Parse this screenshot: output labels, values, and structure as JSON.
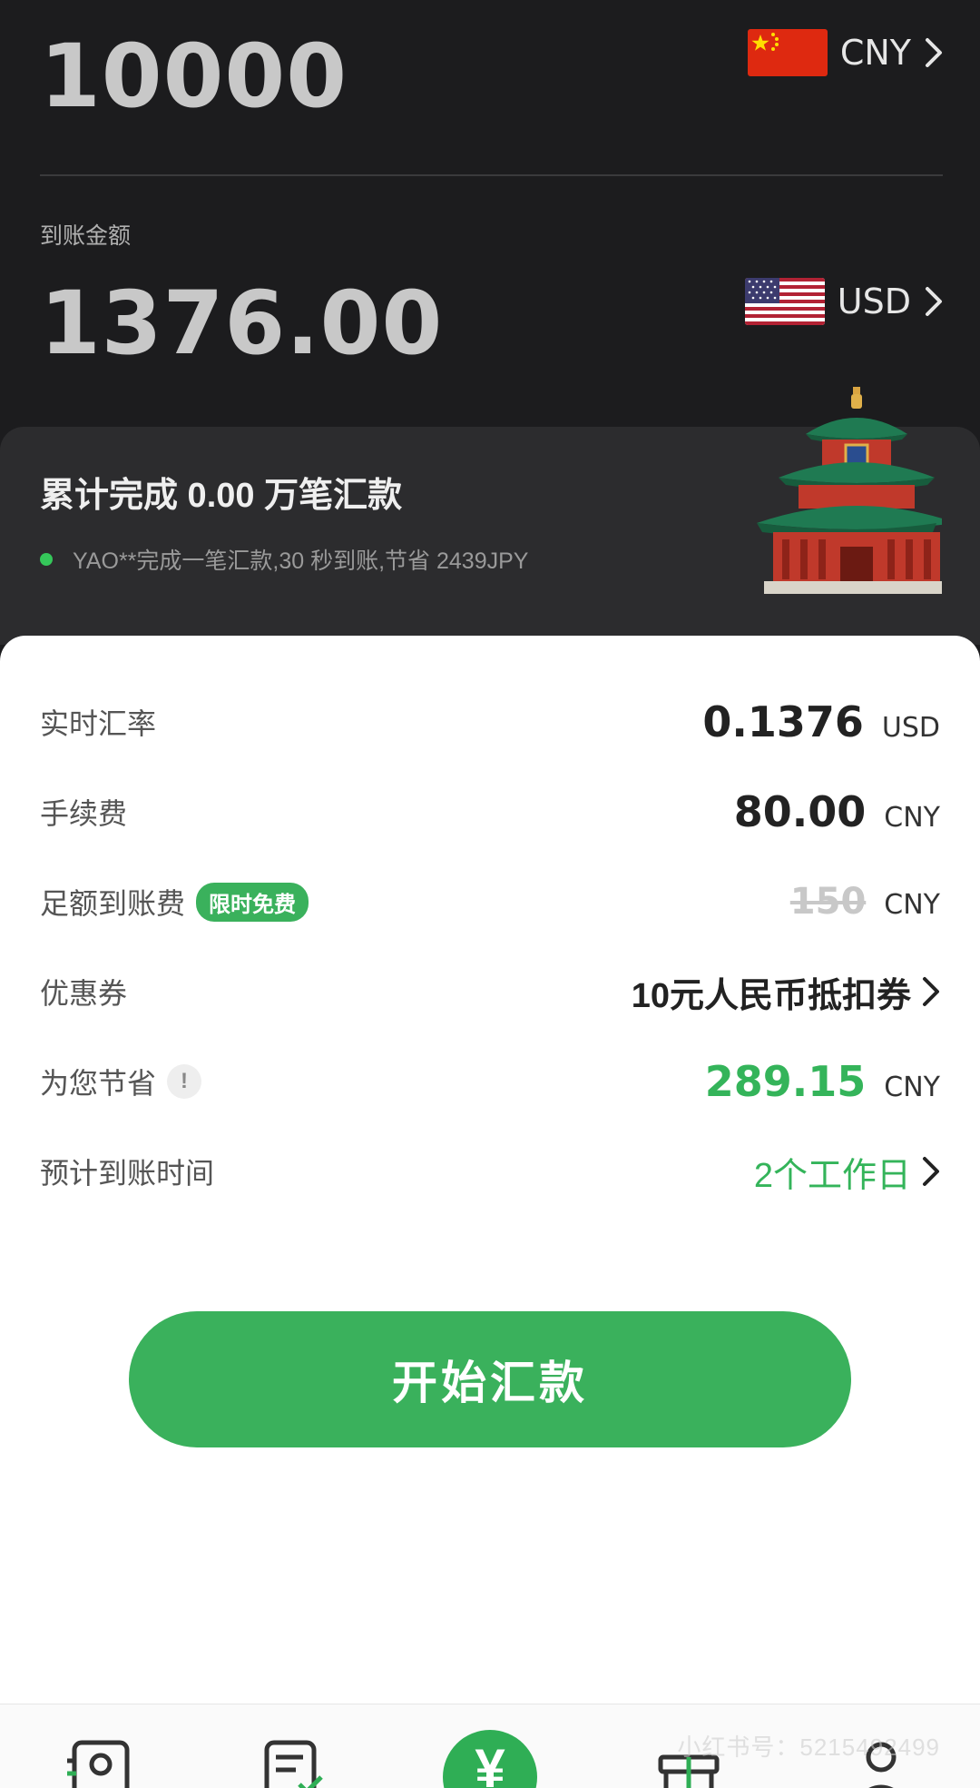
{
  "send": {
    "amount": "10000",
    "currency": "CNY"
  },
  "receive": {
    "label": "到账金额",
    "amount": "1376.00",
    "currency": "USD"
  },
  "stats": {
    "title": "累计完成 0.00 万笔汇款",
    "ticker": "YAO**完成一笔汇款,30 秒到账,节省 2439JPY"
  },
  "details": {
    "rate": {
      "label": "实时汇率",
      "value": "0.1376",
      "unit": "USD"
    },
    "fee": {
      "label": "手续费",
      "value": "80.00",
      "unit": "CNY"
    },
    "full_arrival": {
      "label": "足额到账费",
      "badge": "限时免费",
      "value": "150",
      "unit": "CNY"
    },
    "coupon": {
      "label": "优惠券",
      "value": "10元人民币抵扣券"
    },
    "savings": {
      "label": "为您节省",
      "info": "!",
      "value": "289.15",
      "unit": "CNY"
    },
    "eta": {
      "label": "预计到账时间",
      "value": "2个工作日"
    }
  },
  "cta": {
    "label": "开始汇款"
  },
  "tabbar": {
    "center_symbol": "¥"
  },
  "watermark": "小红书号：5215492499",
  "colors": {
    "accent": "#3ab15c",
    "dark_bg": "#1c1c1e",
    "band_bg": "#2c2c2e"
  }
}
